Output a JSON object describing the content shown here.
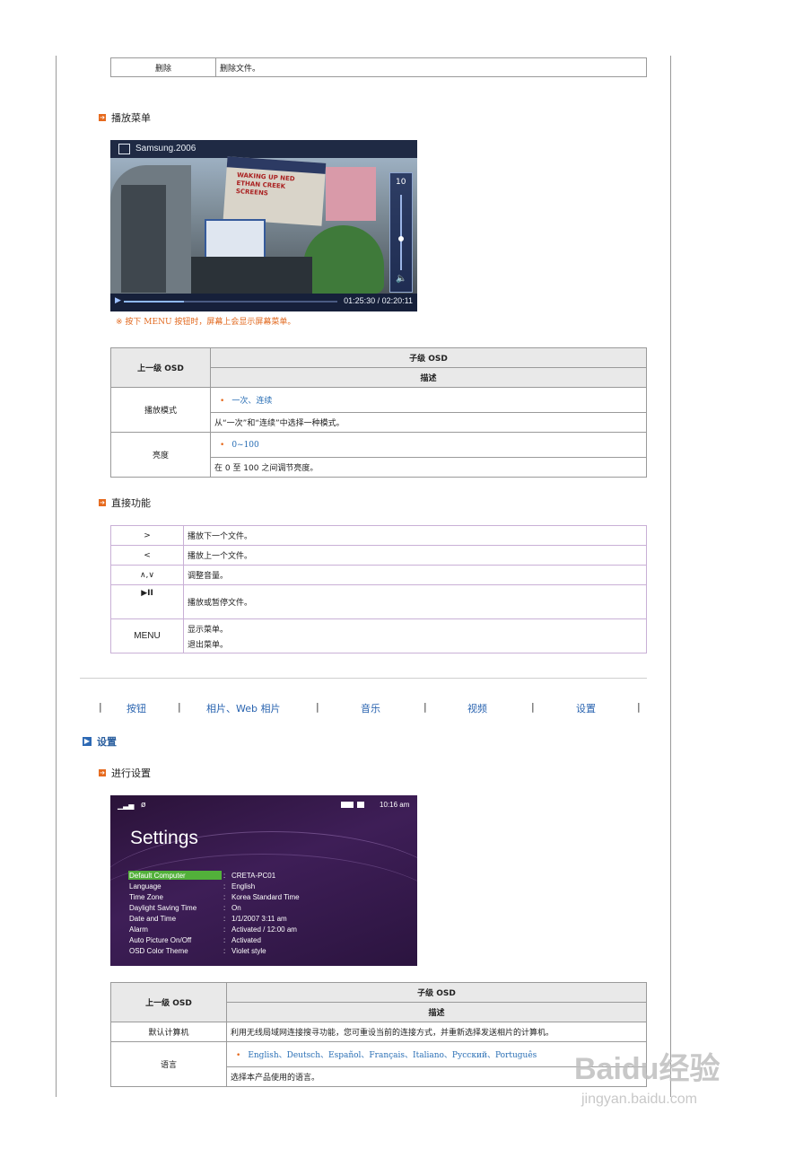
{
  "top_table": {
    "col1": "删除",
    "col2": "删除文件。"
  },
  "section_play_menu": {
    "title": "播放菜单"
  },
  "player": {
    "title": "Samsung.2006",
    "volume_value": "10",
    "time": "01:25:30 / 02:20:11",
    "progress_fraction": 0.28,
    "volume_fraction": 0.42,
    "sign_lines": [
      "WAKING UP NED",
      "ETHAN CREEK",
      "SCREENS"
    ],
    "colors": {
      "titlebar": "#1f2a44",
      "progress": "#8fb9ff"
    }
  },
  "note": {
    "symbol": "※",
    "text": "按下 MENU 按钮时，屏幕上会显示屏幕菜单。"
  },
  "play_table": {
    "head_left": "上一级 OSD",
    "head_sub": "子级 OSD",
    "head_desc": "描述",
    "rows": [
      {
        "name": "播放模式",
        "option": "一次、连续",
        "desc": "从“一次”和“连续”中选择一种模式。"
      },
      {
        "name": "亮度",
        "option": "0~100",
        "desc": "在 0 至 100 之间调节亮度。"
      }
    ]
  },
  "section_direct": {
    "title": "直接功能"
  },
  "direct_table": [
    {
      "key": ">",
      "desc": "播放下一个文件。"
    },
    {
      "key": "<",
      "desc": "播放上一个文件。"
    },
    {
      "key": "∧,∨",
      "desc": "调整音量。"
    },
    {
      "key": "▶II",
      "desc": "播放或暂停文件。"
    },
    {
      "key": "MENU",
      "desc": "显示菜单。",
      "desc2": "退出菜单。"
    }
  ],
  "nav": {
    "sep": "|",
    "items": [
      "按钮",
      "相片、Web 相片",
      "音乐",
      "视频",
      "设置"
    ]
  },
  "section_settings": {
    "title": "设置"
  },
  "section_setup": {
    "title": "进行设置"
  },
  "settings_screen": {
    "time": "10:16 am",
    "title": "Settings",
    "rows": [
      {
        "label": "Default Computer",
        "value": "CRETA-PC01"
      },
      {
        "label": "Language",
        "value": "English"
      },
      {
        "label": "Time Zone",
        "value": "Korea Standard Time"
      },
      {
        "label": "Daylight Saving Time",
        "value": "On"
      },
      {
        "label": "Date and Time",
        "value": "1/1/2007 3:11 am"
      },
      {
        "label": "Alarm",
        "value": "Activated / 12:00 am"
      },
      {
        "label": "Auto Picture On/Off",
        "value": "Activated"
      },
      {
        "label": "OSD Color Theme",
        "value": "Violet style"
      }
    ],
    "colon": ":"
  },
  "settings_table": {
    "head_left": "上一级 OSD",
    "head_sub": "子级 OSD",
    "head_desc": "描述",
    "row1_name": "默认计算机",
    "row1_desc": "利用无线局域网连接搜寻功能，您可重设当前的连接方式，并重新选择发送相片的计算机。",
    "row2_name": "语言",
    "row2_option": "English、Deutsch、Español、Français、Italiano、Русский、Português",
    "row2_desc": "选择本产品使用的语言。"
  },
  "watermark": {
    "line1": "Baidu经验",
    "line2": "jingyan.baidu.com"
  }
}
